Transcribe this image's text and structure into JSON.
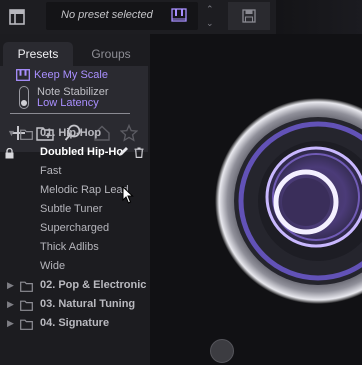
{
  "header": {
    "preset_label": "No preset selected",
    "icons": [
      "panel-layout-icon",
      "midi-icon",
      "chevron-up-icon",
      "chevron-down-icon",
      "save-icon"
    ]
  },
  "tabs": [
    {
      "label": "Presets",
      "active": true
    },
    {
      "label": "Groups",
      "active": false
    }
  ],
  "settings": {
    "keep_scale": "Keep My Scale",
    "stabilizer_label": "Note Stabilizer",
    "stabilizer_value": "Low Latency"
  },
  "toolbar": {
    "icons": [
      "add-icon",
      "new-folder-icon",
      "search-icon",
      "home-icon",
      "star-icon"
    ]
  },
  "tree": {
    "folders": [
      {
        "label": "01. Hip-Hop",
        "expanded": true
      },
      {
        "label": "02. Pop & Electronic",
        "expanded": false
      },
      {
        "label": "03. Natural Tuning",
        "expanded": false
      },
      {
        "label": "04. Signature",
        "expanded": false
      }
    ],
    "hiphop_items": [
      {
        "label": "Doubled Hip-Ho",
        "selected": true,
        "locked": true
      },
      {
        "label": "Fast"
      },
      {
        "label": "Melodic Rap Lead"
      },
      {
        "label": "Subtle Tuner"
      },
      {
        "label": "Supercharged"
      },
      {
        "label": "Thick Adlibs"
      },
      {
        "label": "Wide"
      }
    ]
  },
  "colors": {
    "accent": "#a98fff",
    "background": "#17171a",
    "panel": "#2a2a30"
  }
}
